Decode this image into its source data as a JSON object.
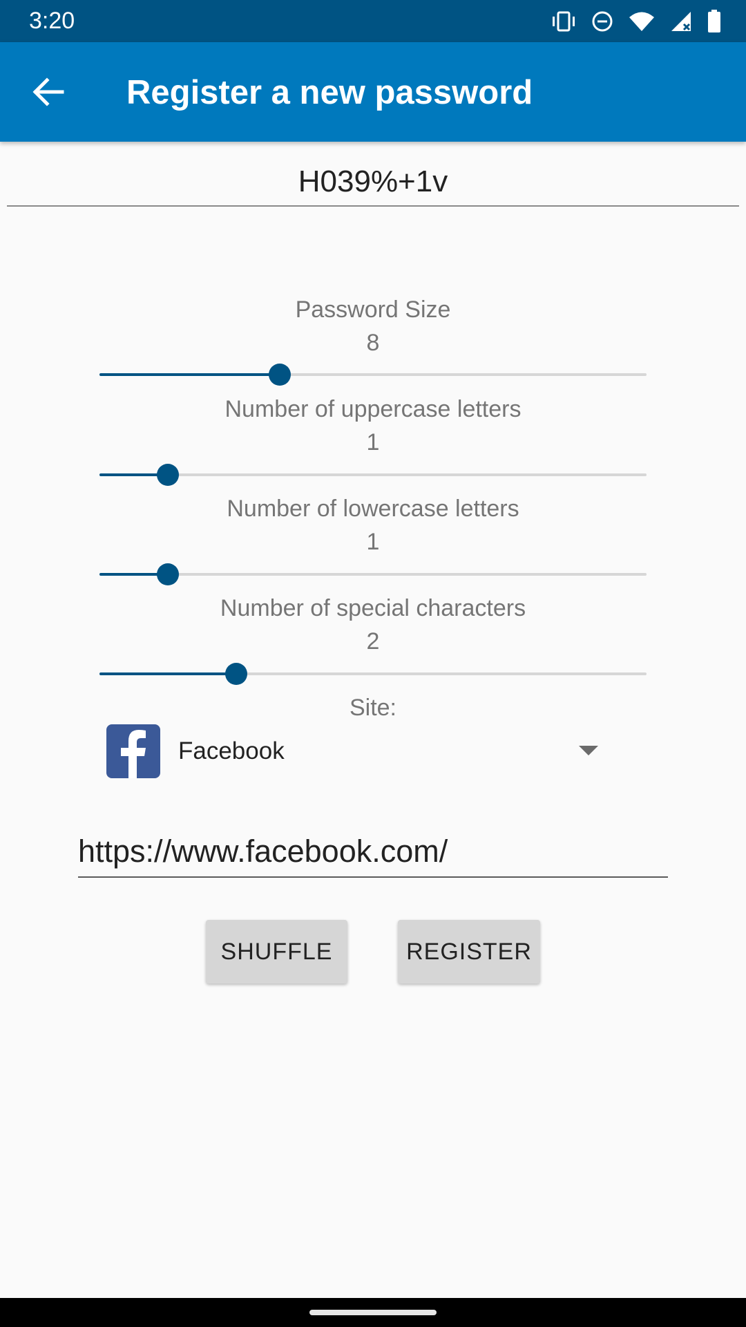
{
  "status_bar": {
    "time": "3:20",
    "icons": [
      "vibrate-icon",
      "do-not-disturb-icon",
      "wifi-icon",
      "signal-icon",
      "battery-icon"
    ]
  },
  "app_bar": {
    "title": "Register a new password",
    "back_icon": "arrow-back-icon",
    "color": "#0079bd"
  },
  "password": {
    "value": "H039%+1v"
  },
  "sliders": [
    {
      "id": "password-size",
      "label": "Password Size",
      "value": "8",
      "fill_fraction": 0.33
    },
    {
      "id": "uppercase",
      "label": "Number of uppercase letters",
      "value": "1",
      "fill_fraction": 0.125
    },
    {
      "id": "lowercase",
      "label": "Number of lowercase letters",
      "value": "1",
      "fill_fraction": 0.125
    },
    {
      "id": "special",
      "label": "Number of special characters",
      "value": "2",
      "fill_fraction": 0.25
    }
  ],
  "site": {
    "label": "Site:",
    "selected": "Facebook",
    "icon": "facebook-logo-icon",
    "url": "https://www.facebook.com/"
  },
  "buttons": {
    "shuffle": "SHUFFLE",
    "register": "REGISTER"
  },
  "colors": {
    "primary": "#0079bd",
    "primary_dark": "#005383",
    "accent": "#005383"
  }
}
